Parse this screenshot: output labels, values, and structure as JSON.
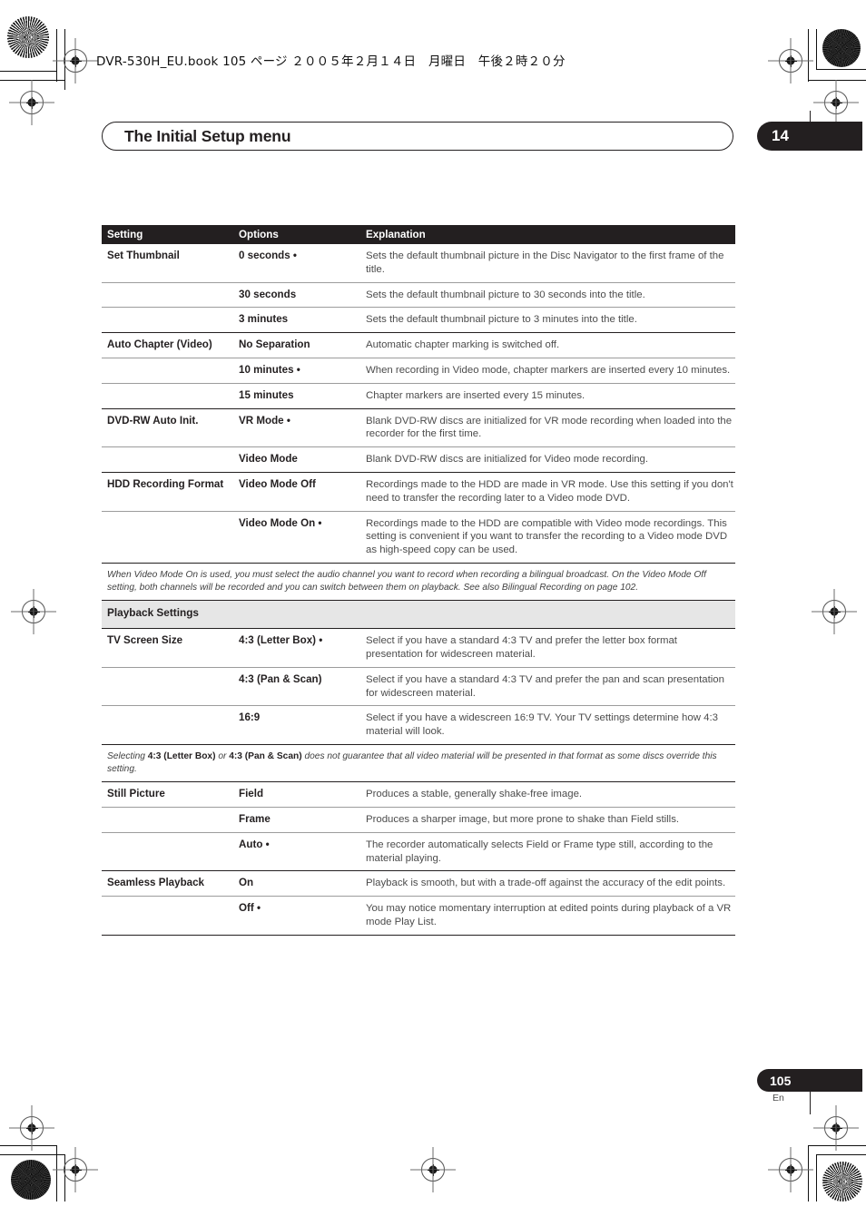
{
  "runhead": {
    "text": "DVR-530H_EU.book  105 ページ  ２００５年２月１４日　月曜日　午後２時２０分"
  },
  "header": {
    "title": "The Initial Setup menu",
    "chapter": "14"
  },
  "table": {
    "columns": [
      "Setting",
      "Options",
      "Explanation"
    ],
    "rows": [
      {
        "setting": "Set Thumbnail",
        "option": "0 seconds •",
        "explanation": "Sets the default thumbnail picture in the Disc Navigator to the first frame of the title.",
        "divider": "thin"
      },
      {
        "setting": "",
        "option": "30 seconds",
        "explanation": "Sets the default thumbnail picture to 30 seconds into the title.",
        "divider": "thin"
      },
      {
        "setting": "",
        "option": "3 minutes",
        "explanation": "Sets the default thumbnail picture to 3 minutes into the title.",
        "divider": "thick"
      },
      {
        "setting": "Auto Chapter (Video)",
        "option": "No Separation",
        "explanation": "Automatic chapter marking is switched off.",
        "divider": "thin"
      },
      {
        "setting": "",
        "option": "10 minutes •",
        "explanation": "When recording in Video mode, chapter markers are inserted every 10 minutes.",
        "divider": "thin"
      },
      {
        "setting": "",
        "option": "15 minutes",
        "explanation": "Chapter markers are inserted every 15 minutes.",
        "divider": "thick"
      },
      {
        "setting": "DVD-RW Auto Init.",
        "option": "VR Mode •",
        "explanation": "Blank DVD-RW discs are initialized for VR mode recording when loaded into the recorder for the first time.",
        "divider": "thin"
      },
      {
        "setting": "",
        "option": "Video Mode",
        "explanation": "Blank DVD-RW discs are initialized for Video mode recording.",
        "divider": "thick"
      },
      {
        "setting": "HDD Recording Format",
        "option": "Video Mode Off",
        "explanation": "Recordings made to the HDD are made in VR mode. Use this setting if you don't need to transfer the recording later to a Video mode DVD.",
        "divider": "thin"
      },
      {
        "setting": "",
        "option": "Video Mode On •",
        "explanation": "Recordings made to the HDD are compatible with Video mode record­ings. This setting is convenient if you want to transfer the recording to a Video mode DVD as high-speed copy can be used.",
        "divider": "thick"
      }
    ],
    "note1": {
      "part1": "When Video Mode On is used, you must select the audio channel you want to record when recording a bilingual broadcast. On the Video Mode Off setting, both channels will be recorded and you can switch between them on playback. See also Bilingual Recording on page 102."
    },
    "section1": "Playback Settings",
    "rows2": [
      {
        "setting": "TV Screen Size",
        "option": "4:3 (Letter Box) •",
        "explanation": "Select if you have a standard 4:3 TV and prefer the letter box format presentation for widescreen material.",
        "divider": "thin"
      },
      {
        "setting": "",
        "option": "4:3 (Pan & Scan)",
        "explanation": "Select if you have a standard 4:3 TV and prefer the pan and scan pre­sentation for widescreen material.",
        "divider": "thin"
      },
      {
        "setting": "",
        "option": "16:9",
        "explanation": "Select if you have a widescreen 16:9 TV. Your TV settings determine how 4:3 material will look.",
        "divider": "thick"
      }
    ],
    "note2": {
      "pre": "Selecting ",
      "b1": "4:3 (Letter Box)",
      "mid": " or ",
      "b2": "4:3 (Pan & Scan)",
      "post": " does not guarantee that all video material will be presented in that format as some discs override this setting."
    },
    "rows3": [
      {
        "setting": "Still Picture",
        "option": "Field",
        "explanation": "Produces a stable, generally shake-free image.",
        "divider": "thin"
      },
      {
        "setting": "",
        "option": "Frame",
        "explanation": "Produces a sharper image, but more prone to shake than Field stills.",
        "divider": "thin"
      },
      {
        "setting": "",
        "option": "Auto •",
        "explanation": "The recorder automatically selects Field or Frame type still, according to the material playing.",
        "divider": "thick"
      },
      {
        "setting": "Seamless Playback",
        "option": "On",
        "explanation": "Playback is smooth, but with a trade-off against the accuracy of the edit points.",
        "divider": "thin"
      },
      {
        "setting": "",
        "option": "Off •",
        "explanation": "You may notice momentary interruption at edited points during play­back of a VR mode Play List.",
        "divider": "thick"
      }
    ]
  },
  "footer": {
    "page": "105",
    "lang": "En"
  }
}
